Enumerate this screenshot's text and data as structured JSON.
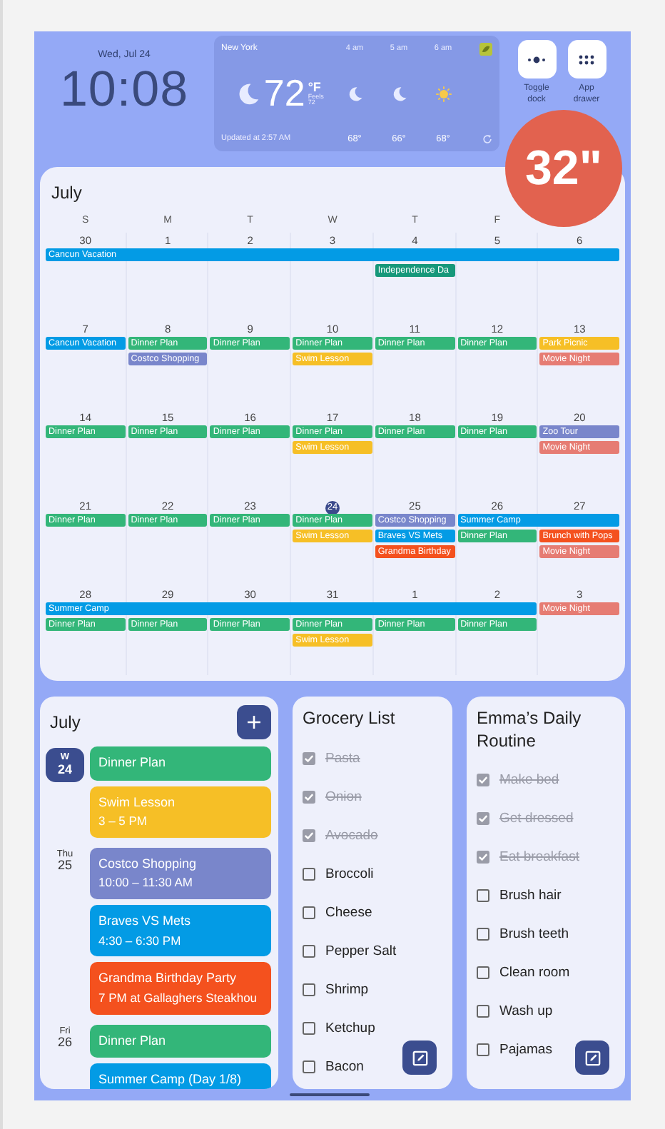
{
  "clock": {
    "date": "Wed, Jul 24",
    "time": "10:08"
  },
  "weather": {
    "city": "New York",
    "kind": "moon",
    "temp": "72",
    "unit": "°F",
    "feels": "Feels 72",
    "updated": "Updated at 2:57 AM",
    "hours": [
      {
        "time": "4 am",
        "kind": "moon",
        "temp": "68°"
      },
      {
        "time": "5 am",
        "kind": "moon",
        "temp": "66°"
      },
      {
        "time": "6 am",
        "kind": "sun",
        "temp": "68°"
      }
    ]
  },
  "buttons": [
    {
      "label": "Toggle dock",
      "kind": "dock"
    },
    {
      "label": "App drawer",
      "kind": "apps"
    }
  ],
  "badge": {
    "text": "32\""
  },
  "calendar": {
    "title": "July",
    "weekdays": [
      "S",
      "M",
      "T",
      "W",
      "T",
      "F"
    ],
    "weeks": [
      {
        "dates": [
          {
            "day": "30",
            "today": false
          },
          {
            "day": "1",
            "today": false
          },
          {
            "day": "2",
            "today": false
          },
          {
            "day": "3",
            "today": false
          },
          {
            "day": "4",
            "today": false
          },
          {
            "day": "5",
            "today": false
          },
          {
            "day": "6",
            "today": false
          }
        ],
        "lanes": [
          [
            {
              "kind": "event",
              "title": "Cancun Vacation",
              "color": "#039be5"
            },
            {
              "kind": "cont"
            },
            {
              "kind": "cont"
            },
            {
              "kind": "cont"
            },
            {
              "kind": "cont"
            },
            {
              "kind": "cont"
            },
            {
              "kind": "cont"
            }
          ],
          [
            {
              "kind": "empty"
            },
            {
              "kind": "empty"
            },
            {
              "kind": "empty"
            },
            {
              "kind": "empty"
            },
            {
              "kind": "event",
              "title": "Independence Da",
              "color": "#16987a"
            },
            {
              "kind": "empty"
            },
            {
              "kind": "empty"
            }
          ]
        ]
      },
      {
        "dates": [
          {
            "day": "7",
            "today": false
          },
          {
            "day": "8",
            "today": false
          },
          {
            "day": "9",
            "today": false
          },
          {
            "day": "10",
            "today": false
          },
          {
            "day": "11",
            "today": false
          },
          {
            "day": "12",
            "today": false
          },
          {
            "day": "13",
            "today": false
          }
        ],
        "lanes": [
          [
            {
              "kind": "event",
              "title": "Cancun Vacation",
              "color": "#039be5"
            },
            {
              "kind": "event",
              "title": "Dinner Plan",
              "color": "#33b679"
            },
            {
              "kind": "event",
              "title": "Dinner Plan",
              "color": "#33b679"
            },
            {
              "kind": "event",
              "title": "Dinner Plan",
              "color": "#33b679"
            },
            {
              "kind": "event",
              "title": "Dinner Plan",
              "color": "#33b679"
            },
            {
              "kind": "event",
              "title": "Dinner Plan",
              "color": "#33b679"
            },
            {
              "kind": "event",
              "title": "Park Picnic",
              "color": "#f6bf26"
            }
          ],
          [
            {
              "kind": "empty"
            },
            {
              "kind": "event",
              "title": "Costco Shopping",
              "color": "#7986cb"
            },
            {
              "kind": "empty"
            },
            {
              "kind": "event",
              "title": "Swim Lesson",
              "color": "#f6bf26"
            },
            {
              "kind": "empty"
            },
            {
              "kind": "empty"
            },
            {
              "kind": "event",
              "title": "Movie Night",
              "color": "#e67c73"
            }
          ]
        ]
      },
      {
        "dates": [
          {
            "day": "14",
            "today": false
          },
          {
            "day": "15",
            "today": false
          },
          {
            "day": "16",
            "today": false
          },
          {
            "day": "17",
            "today": false
          },
          {
            "day": "18",
            "today": false
          },
          {
            "day": "19",
            "today": false
          },
          {
            "day": "20",
            "today": false
          }
        ],
        "lanes": [
          [
            {
              "kind": "event",
              "title": "Dinner Plan",
              "color": "#33b679"
            },
            {
              "kind": "event",
              "title": "Dinner Plan",
              "color": "#33b679"
            },
            {
              "kind": "event",
              "title": "Dinner Plan",
              "color": "#33b679"
            },
            {
              "kind": "event",
              "title": "Dinner Plan",
              "color": "#33b679"
            },
            {
              "kind": "event",
              "title": "Dinner Plan",
              "color": "#33b679"
            },
            {
              "kind": "event",
              "title": "Dinner Plan",
              "color": "#33b679"
            },
            {
              "kind": "event",
              "title": "Zoo Tour",
              "color": "#7986cb"
            }
          ],
          [
            {
              "kind": "empty"
            },
            {
              "kind": "empty"
            },
            {
              "kind": "empty"
            },
            {
              "kind": "event",
              "title": "Swim Lesson",
              "color": "#f6bf26"
            },
            {
              "kind": "empty"
            },
            {
              "kind": "empty"
            },
            {
              "kind": "event",
              "title": "Movie Night",
              "color": "#e67c73"
            }
          ]
        ]
      },
      {
        "dates": [
          {
            "day": "21",
            "today": false
          },
          {
            "day": "22",
            "today": false
          },
          {
            "day": "23",
            "today": false
          },
          {
            "day": "24",
            "today": true
          },
          {
            "day": "25",
            "today": false
          },
          {
            "day": "26",
            "today": false
          },
          {
            "day": "27",
            "today": false
          }
        ],
        "lanes": [
          [
            {
              "kind": "event",
              "title": "Dinner Plan",
              "color": "#33b679"
            },
            {
              "kind": "event",
              "title": "Dinner Plan",
              "color": "#33b679"
            },
            {
              "kind": "event",
              "title": "Dinner Plan",
              "color": "#33b679"
            },
            {
              "kind": "event",
              "title": "Dinner Plan",
              "color": "#33b679"
            },
            {
              "kind": "event",
              "title": "Costco Shopping",
              "color": "#7986cb"
            },
            {
              "kind": "event",
              "title": "Summer Camp",
              "color": "#039be5"
            },
            {
              "kind": "cont"
            }
          ],
          [
            {
              "kind": "empty"
            },
            {
              "kind": "empty"
            },
            {
              "kind": "empty"
            },
            {
              "kind": "event",
              "title": "Swim Lesson",
              "color": "#f6bf26"
            },
            {
              "kind": "event",
              "title": "Braves VS Mets",
              "color": "#039be5"
            },
            {
              "kind": "event",
              "title": "Dinner Plan",
              "color": "#33b679"
            },
            {
              "kind": "event",
              "title": "Brunch with Pops",
              "color": "#f4511e"
            }
          ],
          [
            {
              "kind": "empty"
            },
            {
              "kind": "empty"
            },
            {
              "kind": "empty"
            },
            {
              "kind": "empty"
            },
            {
              "kind": "event",
              "title": "Grandma Birthday",
              "color": "#f4511e"
            },
            {
              "kind": "empty"
            },
            {
              "kind": "event",
              "title": "Movie Night",
              "color": "#e67c73"
            }
          ]
        ]
      },
      {
        "dates": [
          {
            "day": "28",
            "today": false
          },
          {
            "day": "29",
            "today": false
          },
          {
            "day": "30",
            "today": false
          },
          {
            "day": "31",
            "today": false
          },
          {
            "day": "1",
            "today": false
          },
          {
            "day": "2",
            "today": false
          },
          {
            "day": "3",
            "today": false
          }
        ],
        "lanes": [
          [
            {
              "kind": "event",
              "title": "Summer Camp",
              "color": "#039be5"
            },
            {
              "kind": "cont"
            },
            {
              "kind": "cont"
            },
            {
              "kind": "cont"
            },
            {
              "kind": "cont"
            },
            {
              "kind": "cont"
            },
            {
              "kind": "event",
              "title": "Movie Night",
              "color": "#e67c73"
            }
          ],
          [
            {
              "kind": "event",
              "title": "Dinner Plan",
              "color": "#33b679"
            },
            {
              "kind": "event",
              "title": "Dinner Plan",
              "color": "#33b679"
            },
            {
              "kind": "event",
              "title": "Dinner Plan",
              "color": "#33b679"
            },
            {
              "kind": "event",
              "title": "Dinner Plan",
              "color": "#33b679"
            },
            {
              "kind": "event",
              "title": "Dinner Plan",
              "color": "#33b679"
            },
            {
              "kind": "event",
              "title": "Dinner Plan",
              "color": "#33b679"
            },
            {
              "kind": "empty"
            }
          ],
          [
            {
              "kind": "empty"
            },
            {
              "kind": "empty"
            },
            {
              "kind": "empty"
            },
            {
              "kind": "event",
              "title": "Swim Lesson",
              "color": "#f6bf26"
            },
            {
              "kind": "empty"
            },
            {
              "kind": "empty"
            },
            {
              "kind": "empty"
            }
          ]
        ]
      }
    ]
  },
  "agenda": {
    "title": "July",
    "days": [
      {
        "weekday": "W",
        "date": "24",
        "today": true,
        "events": [
          {
            "title": "Dinner Plan",
            "color": "#33b679"
          },
          {
            "title": "Swim Lesson",
            "time": "3 – 5 PM",
            "color": "#f6bf26"
          }
        ]
      },
      {
        "weekday": "Thu",
        "date": "25",
        "today": false,
        "events": [
          {
            "title": "Costco Shopping",
            "time": "10:00 – 11:30 AM",
            "color": "#7986cb"
          },
          {
            "title": "Braves VS Mets",
            "time": "4:30 – 6:30 PM",
            "color": "#039be5"
          },
          {
            "title": "Grandma Birthday Party",
            "time": "7 PM at Gallaghers Steakhou",
            "color": "#f4511e"
          }
        ]
      },
      {
        "weekday": "Fri",
        "date": "26",
        "today": false,
        "events": [
          {
            "title": "Dinner Plan",
            "color": "#33b679"
          },
          {
            "title": "Summer Camp (Day 1/8)",
            "color": "#039be5"
          }
        ]
      }
    ]
  },
  "lists": [
    {
      "title": "Grocery List",
      "items": [
        {
          "text": "Pasta",
          "checked": true
        },
        {
          "text": "Onion",
          "checked": true
        },
        {
          "text": "Avocado",
          "checked": true
        },
        {
          "text": "Broccoli",
          "checked": false
        },
        {
          "text": "Cheese",
          "checked": false
        },
        {
          "text": "Pepper Salt",
          "checked": false
        },
        {
          "text": "Shrimp",
          "checked": false
        },
        {
          "text": "Ketchup",
          "checked": false
        },
        {
          "text": "Bacon",
          "checked": false
        }
      ]
    },
    {
      "title": "Emma’s Daily Routine",
      "items": [
        {
          "text": "Make bed",
          "checked": true
        },
        {
          "text": "Get dressed",
          "checked": true
        },
        {
          "text": "Eat breakfast",
          "checked": true
        },
        {
          "text": "Brush hair",
          "checked": false
        },
        {
          "text": "Brush teeth",
          "checked": false
        },
        {
          "text": "Clean room",
          "checked": false
        },
        {
          "text": "Wash up",
          "checked": false
        },
        {
          "text": "Pajamas",
          "checked": false
        }
      ]
    }
  ]
}
